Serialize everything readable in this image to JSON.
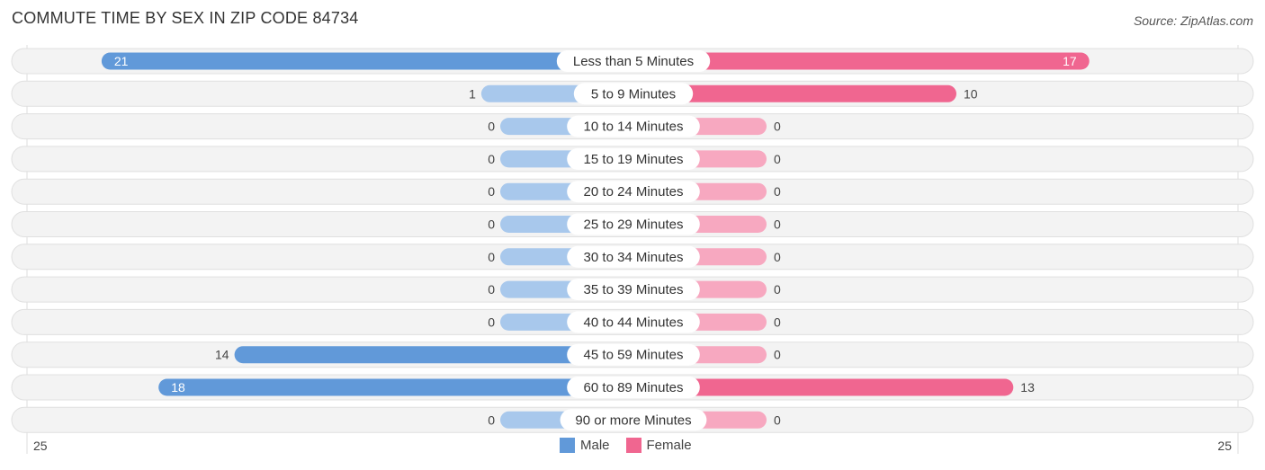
{
  "header": {
    "title": "COMMUTE TIME BY SEX IN ZIP CODE 84734",
    "source": "Source: ZipAtlas.com"
  },
  "chart_data": {
    "type": "bar",
    "orientation": "horizontal-diverging",
    "title": "COMMUTE TIME BY SEX IN ZIP CODE 84734",
    "categories": [
      "Less than 5 Minutes",
      "5 to 9 Minutes",
      "10 to 14 Minutes",
      "15 to 19 Minutes",
      "20 to 24 Minutes",
      "25 to 29 Minutes",
      "30 to 34 Minutes",
      "35 to 39 Minutes",
      "40 to 44 Minutes",
      "45 to 59 Minutes",
      "60 to 89 Minutes",
      "90 or more Minutes"
    ],
    "series": [
      {
        "name": "Male",
        "color": "#6199d9",
        "light_color": "#a8c8ec",
        "values": [
          21,
          1,
          0,
          0,
          0,
          0,
          0,
          0,
          0,
          14,
          18,
          0
        ]
      },
      {
        "name": "Female",
        "color": "#f06690",
        "light_color": "#f7a8c0",
        "values": [
          17,
          10,
          0,
          0,
          0,
          0,
          0,
          0,
          0,
          0,
          13,
          0
        ]
      }
    ],
    "axis": {
      "left_label": "25",
      "right_label": "25",
      "max": 25
    },
    "legend": {
      "position": "bottom-center",
      "entries": [
        "Male",
        "Female"
      ]
    }
  }
}
